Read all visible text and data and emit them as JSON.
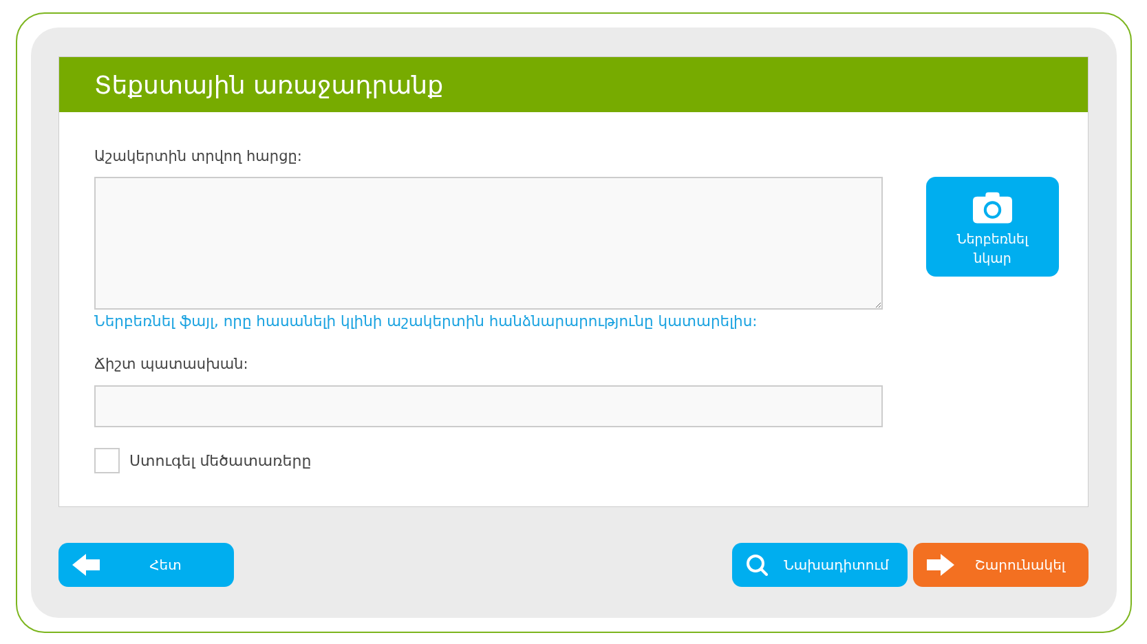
{
  "header": {
    "title": "Տեքստային առաջադրանք"
  },
  "question": {
    "label": "Աշակերտին տրվող հարցը:",
    "hint": "Ներբեռնել ֆայլ, որը հասանելի կլինի աշակերտին հանձնարարությունը կատարելիս:"
  },
  "upload_button": {
    "label": "Ներբեռնել նկար"
  },
  "answer": {
    "label": "Ճիշտ պատասխան:"
  },
  "case_check": {
    "label": "Ստուգել մեծատառերը",
    "checked": false
  },
  "buttons": [
    {
      "kind": "back",
      "label": "Հետ"
    },
    {
      "kind": "preview",
      "label": "Նախադիտում"
    },
    {
      "kind": "continue",
      "label": "Շարունակել"
    }
  ]
}
